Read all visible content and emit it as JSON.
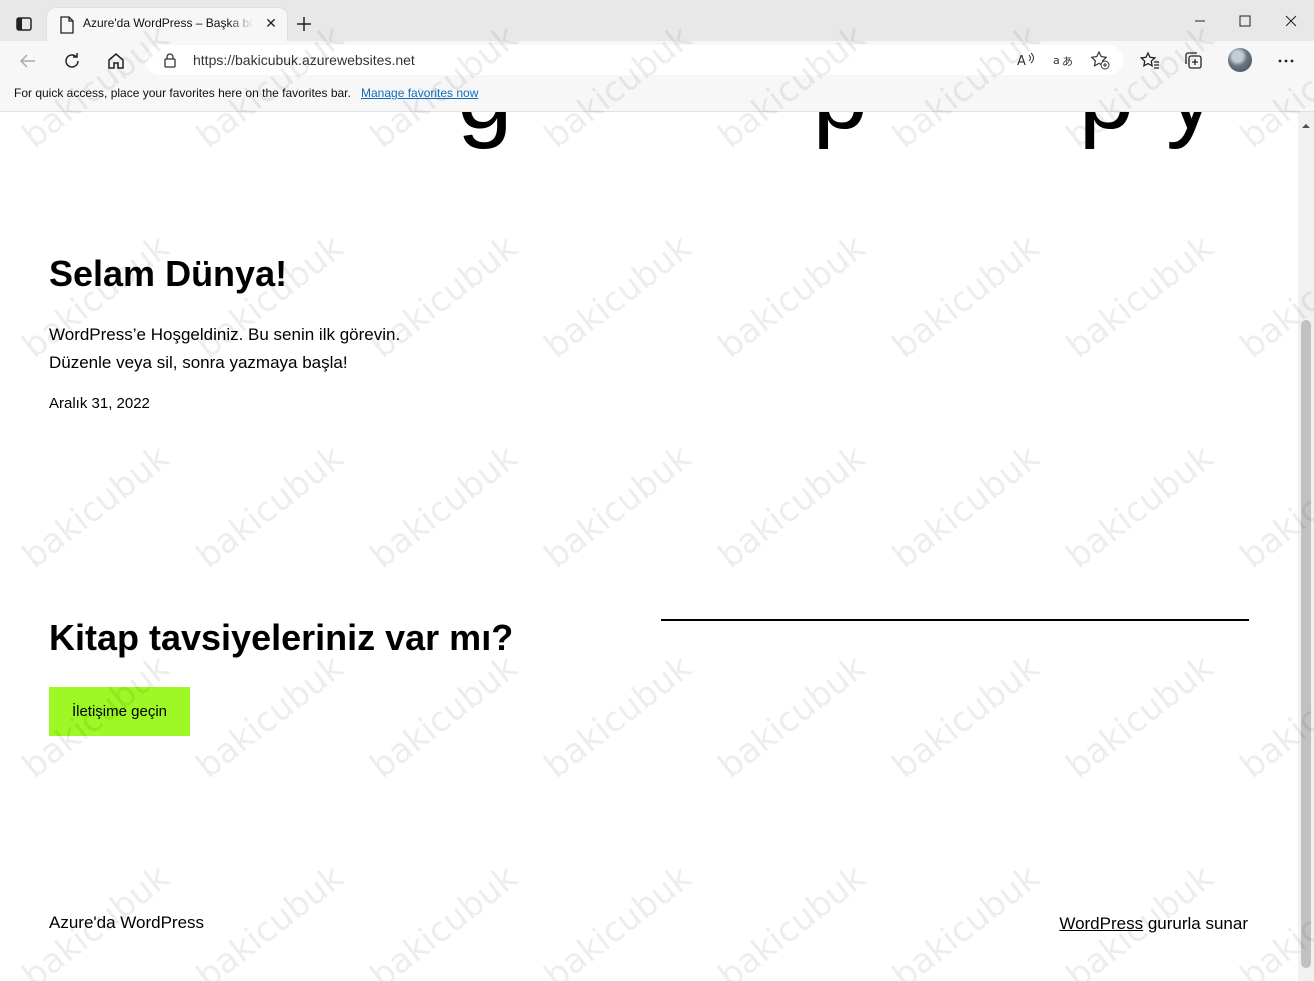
{
  "browser": {
    "tab": {
      "title": "Azure'da WordPress – Başka bir WordPress sitesi"
    },
    "address": {
      "url": "https://bakicubuk.azurewebsites.net"
    },
    "favorites_bar": {
      "message": "For quick access, place your favorites here on the favorites bar.",
      "link": "Manage favorites now"
    },
    "icons": {
      "tab_actions": "tab-actions-icon",
      "page": "page-icon",
      "close": "close-icon",
      "new_tab": "plus-icon",
      "minimize": "minimize-icon",
      "maximize": "maximize-icon",
      "close_window": "close-window-icon",
      "back": "back-arrow-icon",
      "reload": "reload-icon",
      "home": "home-icon",
      "lock": "lock-icon",
      "read_aloud": "read-aloud-icon",
      "translate": "translate-icon",
      "add_favorite": "star-plus-icon",
      "favorites": "favorites-icon",
      "collections": "collections-icon",
      "profile": "avatar",
      "more": "more-icon"
    }
  },
  "page": {
    "post": {
      "title": "Selam Dünya!",
      "excerpt": "WordPress’e Hoşgeldiniz. Bu senin ilk görevin. Düzenle veya sil, sonra yazmaya başla!",
      "date": "Aralık 31, 2022"
    },
    "cta": {
      "heading": "Kitap tavsiyeleriniz var mı?",
      "button": "İletişime geçin"
    },
    "footer": {
      "site_name": "Azure'da WordPress",
      "credit_link": "WordPress",
      "credit_text": "gururla sunar"
    }
  },
  "watermark": {
    "text": "bakicubuk"
  },
  "colors": {
    "cta_button": "#9ef825",
    "link": "#0f6cbd",
    "chrome": "#f7f7f7"
  }
}
